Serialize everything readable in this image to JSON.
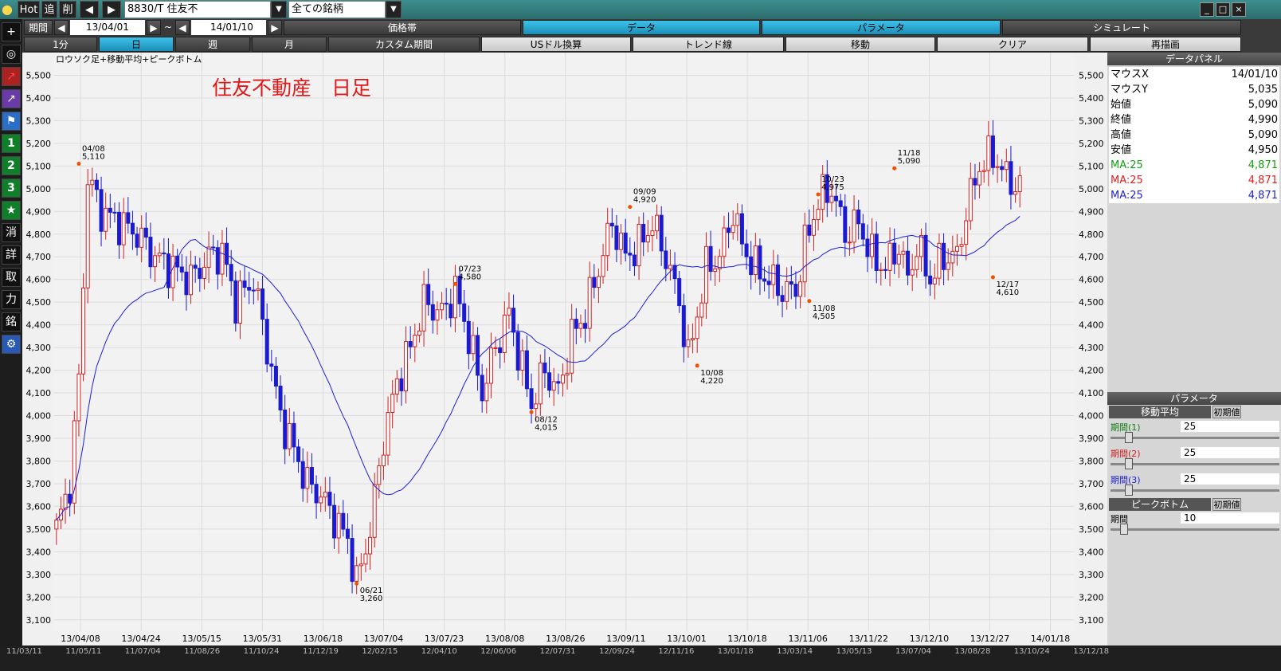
{
  "toolbar": {
    "hot": "Hot",
    "add": "追",
    "del": "削",
    "symbol": "8830/T 住友不",
    "market": "全ての銘柄"
  },
  "period_bar": {
    "label": "期間",
    "from": "13/04/01",
    "tilde": "~",
    "to": "14/01/10",
    "tabs": [
      "価格帯",
      "データ",
      "パラメータ",
      "シミュレート"
    ]
  },
  "sub_tabs": [
    "1分",
    "日",
    "週",
    "月",
    "カスタム期間",
    "USドル換算",
    "トレンド線",
    "移動",
    "クリア",
    "再描画"
  ],
  "side_buttons": [
    "+",
    "◎",
    "↗",
    "↗",
    "⚑",
    "1",
    "2",
    "3",
    "★",
    "消",
    "詳",
    "取",
    "力",
    "銘",
    "⚙"
  ],
  "chart_data": {
    "type": "candlestick",
    "title": "住友不動産　日足",
    "subtitle": "ロウソク足+移動平均+ピークボトム",
    "ylim": [
      3050,
      5600
    ],
    "y_ticks": [
      "5,500",
      "5,400",
      "5,300",
      "5,200",
      "5,100",
      "5,000",
      "4,900",
      "4,800",
      "4,700",
      "4,600",
      "4,500",
      "4,400",
      "4,300",
      "4,200",
      "4,100",
      "4,000",
      "3,900",
      "3,800",
      "3,700",
      "3,600",
      "3,500",
      "3,400",
      "3,300",
      "3,200",
      "3,100"
    ],
    "x_ticks": [
      "13/04/08",
      "13/04/24",
      "13/05/15",
      "13/05/31",
      "13/06/18",
      "13/07/04",
      "13/07/23",
      "13/08/08",
      "13/08/26",
      "13/09/11",
      "13/10/01",
      "13/10/18",
      "13/11/06",
      "13/11/22",
      "13/12/10",
      "13/12/27",
      "14/01/18"
    ],
    "peaks": [
      {
        "date": "04/08",
        "value": "5,110"
      },
      {
        "date": "06/21",
        "value": "3,260"
      },
      {
        "date": "07/23",
        "value": "4,580"
      },
      {
        "date": "08/12",
        "value": "4,015"
      },
      {
        "date": "09/09",
        "value": "4,920"
      },
      {
        "date": "10/08",
        "value": "4,220"
      },
      {
        "date": "10/23",
        "value": "4,975"
      },
      {
        "date": "11/08",
        "value": "4,505"
      },
      {
        "date": "11/18",
        "value": "5,090"
      },
      {
        "date": "12/17",
        "value": "4,610"
      }
    ]
  },
  "bottom_axis": [
    "11/03/11",
    "11/05/11",
    "11/07/04",
    "11/08/26",
    "11/10/24",
    "11/12/19",
    "12/02/15",
    "12/04/10",
    "12/06/06",
    "12/07/31",
    "12/09/24",
    "12/11/16",
    "13/01/18",
    "13/03/14",
    "13/05/13",
    "13/07/04",
    "13/08/28",
    "13/10/24",
    "13/12/18"
  ],
  "data_panel": {
    "title": "データパネル",
    "rows": [
      {
        "k": "マウスX",
        "v": "14/01/10"
      },
      {
        "k": "マウスY",
        "v": "5,035"
      },
      {
        "k": "始値",
        "v": "5,090"
      },
      {
        "k": "終値",
        "v": "4,990"
      },
      {
        "k": "高値",
        "v": "5,090"
      },
      {
        "k": "安値",
        "v": "4,950"
      },
      {
        "k": "MA:25",
        "v": "4,871",
        "color": "#10a010"
      },
      {
        "k": "MA:25",
        "v": "4,871",
        "color": "#e02020"
      },
      {
        "k": "MA:25",
        "v": "4,871",
        "color": "#2020e0"
      }
    ]
  },
  "param_panel": {
    "title": "パラメータ",
    "ma_label": "移動平均",
    "reset": "初期値",
    "periods": [
      {
        "label": "期間(1)",
        "value": "25",
        "color": "#108010"
      },
      {
        "label": "期間(2)",
        "value": "25",
        "color": "#d02020"
      },
      {
        "label": "期間(3)",
        "value": "25",
        "color": "#2020d0"
      }
    ],
    "pb_label": "ピークボトム",
    "pb_reset": "初期値",
    "pb_period_label": "期間",
    "pb_period_value": "10"
  }
}
